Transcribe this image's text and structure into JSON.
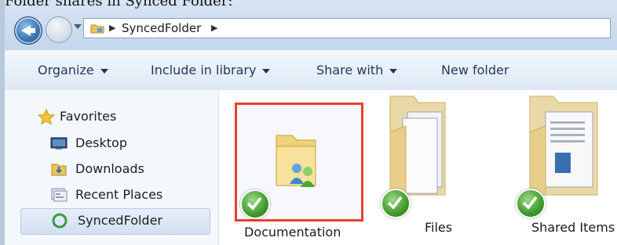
{
  "caption": "Folder shares in Synced Folder:",
  "address": {
    "path_segment": "SyncedFolder"
  },
  "toolbar": {
    "organize": "Organize",
    "include_in_library": "Include in library",
    "share_with": "Share with",
    "new_folder": "New folder"
  },
  "navpane": {
    "favorites_header": "Favorites",
    "items": [
      {
        "label": "Desktop",
        "icon": "desktop-icon"
      },
      {
        "label": "Downloads",
        "icon": "downloads-folder-icon"
      },
      {
        "label": "Recent Places",
        "icon": "recent-places-icon"
      },
      {
        "label": "SyncedFolder",
        "icon": "synced-folder-icon",
        "selected": true
      }
    ]
  },
  "content": {
    "items": [
      {
        "label": "Documentation",
        "icon": "shared-folder-icon",
        "status": "synced",
        "selected": true
      },
      {
        "label": "Files",
        "icon": "folder-icon",
        "status": "synced"
      },
      {
        "label": "Shared Items",
        "icon": "folder-icon",
        "status": "synced"
      }
    ]
  },
  "colors": {
    "selection_border": "#e8412a",
    "sync_check": "#3f9a2a",
    "toolbar_text": "#1e395b"
  }
}
